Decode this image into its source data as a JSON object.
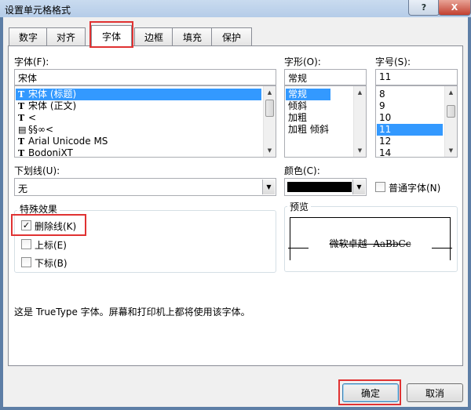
{
  "window": {
    "title": "设置单元格格式",
    "help_label": "?",
    "close_label": "X"
  },
  "tabs": [
    "数字",
    "对齐",
    "字体",
    "边框",
    "填充",
    "保护"
  ],
  "font": {
    "label": "字体(F):",
    "value": "宋体",
    "list": [
      "宋体 (标题)",
      "宋体 (正文)",
      "<",
      "§§∞<",
      "Arial Unicode MS",
      "BodoniXT"
    ],
    "selected_index": 0
  },
  "style": {
    "label": "字形(O):",
    "value": "常规",
    "list": [
      "常规",
      "倾斜",
      "加粗",
      "加粗 倾斜"
    ],
    "selected_index": 0
  },
  "size": {
    "label": "字号(S):",
    "value": "11",
    "list": [
      "8",
      "9",
      "10",
      "11",
      "12",
      "14"
    ],
    "selected_index": 3
  },
  "underline": {
    "label": "下划线(U):",
    "value": "无"
  },
  "color": {
    "label": "颜色(C):",
    "swatch": "#000000",
    "normal_font_label": "普通字体(N)",
    "normal_font_checked": false
  },
  "effects": {
    "title": "特殊效果",
    "strikethrough": {
      "label": "删除线(K)",
      "checked": true
    },
    "superscript": {
      "label": "上标(E)",
      "checked": false
    },
    "subscript": {
      "label": "下标(B)",
      "checked": false
    }
  },
  "preview": {
    "title": "预览",
    "sample": "微软卓越  AaBbCc"
  },
  "info_text": "这是 TrueType 字体。屏幕和打印机上都将使用该字体。",
  "buttons": {
    "ok": "确定",
    "cancel": "取消"
  },
  "colors": {
    "highlight": "#e03232",
    "selection": "#3399ff"
  }
}
